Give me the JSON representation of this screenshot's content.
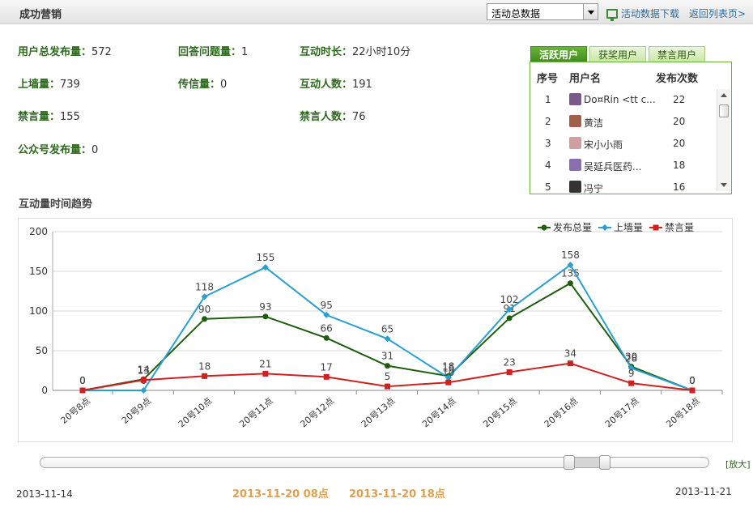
{
  "header": {
    "title": "成功营销",
    "select_value": "活动总数据",
    "download_label": "活动数据下载",
    "back_label": "返回列表页>"
  },
  "stats": {
    "total_posts": {
      "label": "用户总发布量：",
      "value": "572"
    },
    "answers": {
      "label": "回答问题量：",
      "value": "1"
    },
    "duration": {
      "label": "互动时长：",
      "value": "22小时10分"
    },
    "wall": {
      "label": "上墙量：",
      "value": "739"
    },
    "letters": {
      "label": "传信量：",
      "value": "0"
    },
    "participants": {
      "label": "互动人数：",
      "value": "191"
    },
    "muted": {
      "label": "禁言量：",
      "value": "155"
    },
    "muted_users": {
      "label": "禁言人数：",
      "value": "76"
    },
    "public_posts": {
      "label": "公众号发布量：",
      "value": "0"
    }
  },
  "user_panel": {
    "tabs": [
      "活跃用户",
      "获奖用户",
      "禁言用户"
    ],
    "columns": [
      "序号",
      "用户名",
      "发布次数"
    ],
    "rows": [
      {
        "rank": "1",
        "name": "Do¤Rin <tt c...",
        "count": "22"
      },
      {
        "rank": "2",
        "name": "黄洁",
        "count": "20"
      },
      {
        "rank": "3",
        "name": "宋小小雨",
        "count": "20"
      },
      {
        "rank": "4",
        "name": "吴延兵医药...",
        "count": "18"
      },
      {
        "rank": "5",
        "name": "冯宁",
        "count": "16"
      }
    ],
    "avatar_colors": [
      "#7a5a8a",
      "#a0604a",
      "#d0a0a0",
      "#8a6fb0",
      "#333333"
    ]
  },
  "section_title": "互动量时间趋势",
  "chart_data": {
    "type": "line",
    "categories": [
      "20号8点",
      "20号9点",
      "20号10点",
      "20号11点",
      "20号12点",
      "20号13点",
      "20号14点",
      "20号15点",
      "20号16点",
      "20号17点",
      "20号18点"
    ],
    "series": [
      {
        "name": "发布总量",
        "color": "#1e5d0e",
        "marker": "circle",
        "values": [
          0,
          14,
          90,
          93,
          66,
          31,
          18,
          91,
          135,
          30,
          0
        ]
      },
      {
        "name": "上墙量",
        "color": "#2a9fd0",
        "marker": "diamond",
        "values": [
          0,
          0,
          118,
          155,
          95,
          65,
          16,
          102,
          158,
          28,
          0
        ]
      },
      {
        "name": "禁言量",
        "color": "#d02020",
        "marker": "square",
        "values": [
          0,
          13,
          18,
          21,
          17,
          5,
          10,
          23,
          34,
          9,
          0
        ]
      }
    ],
    "yticks": [
      0,
      50,
      100,
      150,
      200
    ],
    "ylim": [
      0,
      200
    ],
    "legend": "top-right",
    "grid": true
  },
  "range": {
    "start": "2013-11-14",
    "end": "2013-11-21",
    "from": "2013-11-20 08点",
    "to": "2013-11-20 18点",
    "zoom_label": "[放大]"
  }
}
